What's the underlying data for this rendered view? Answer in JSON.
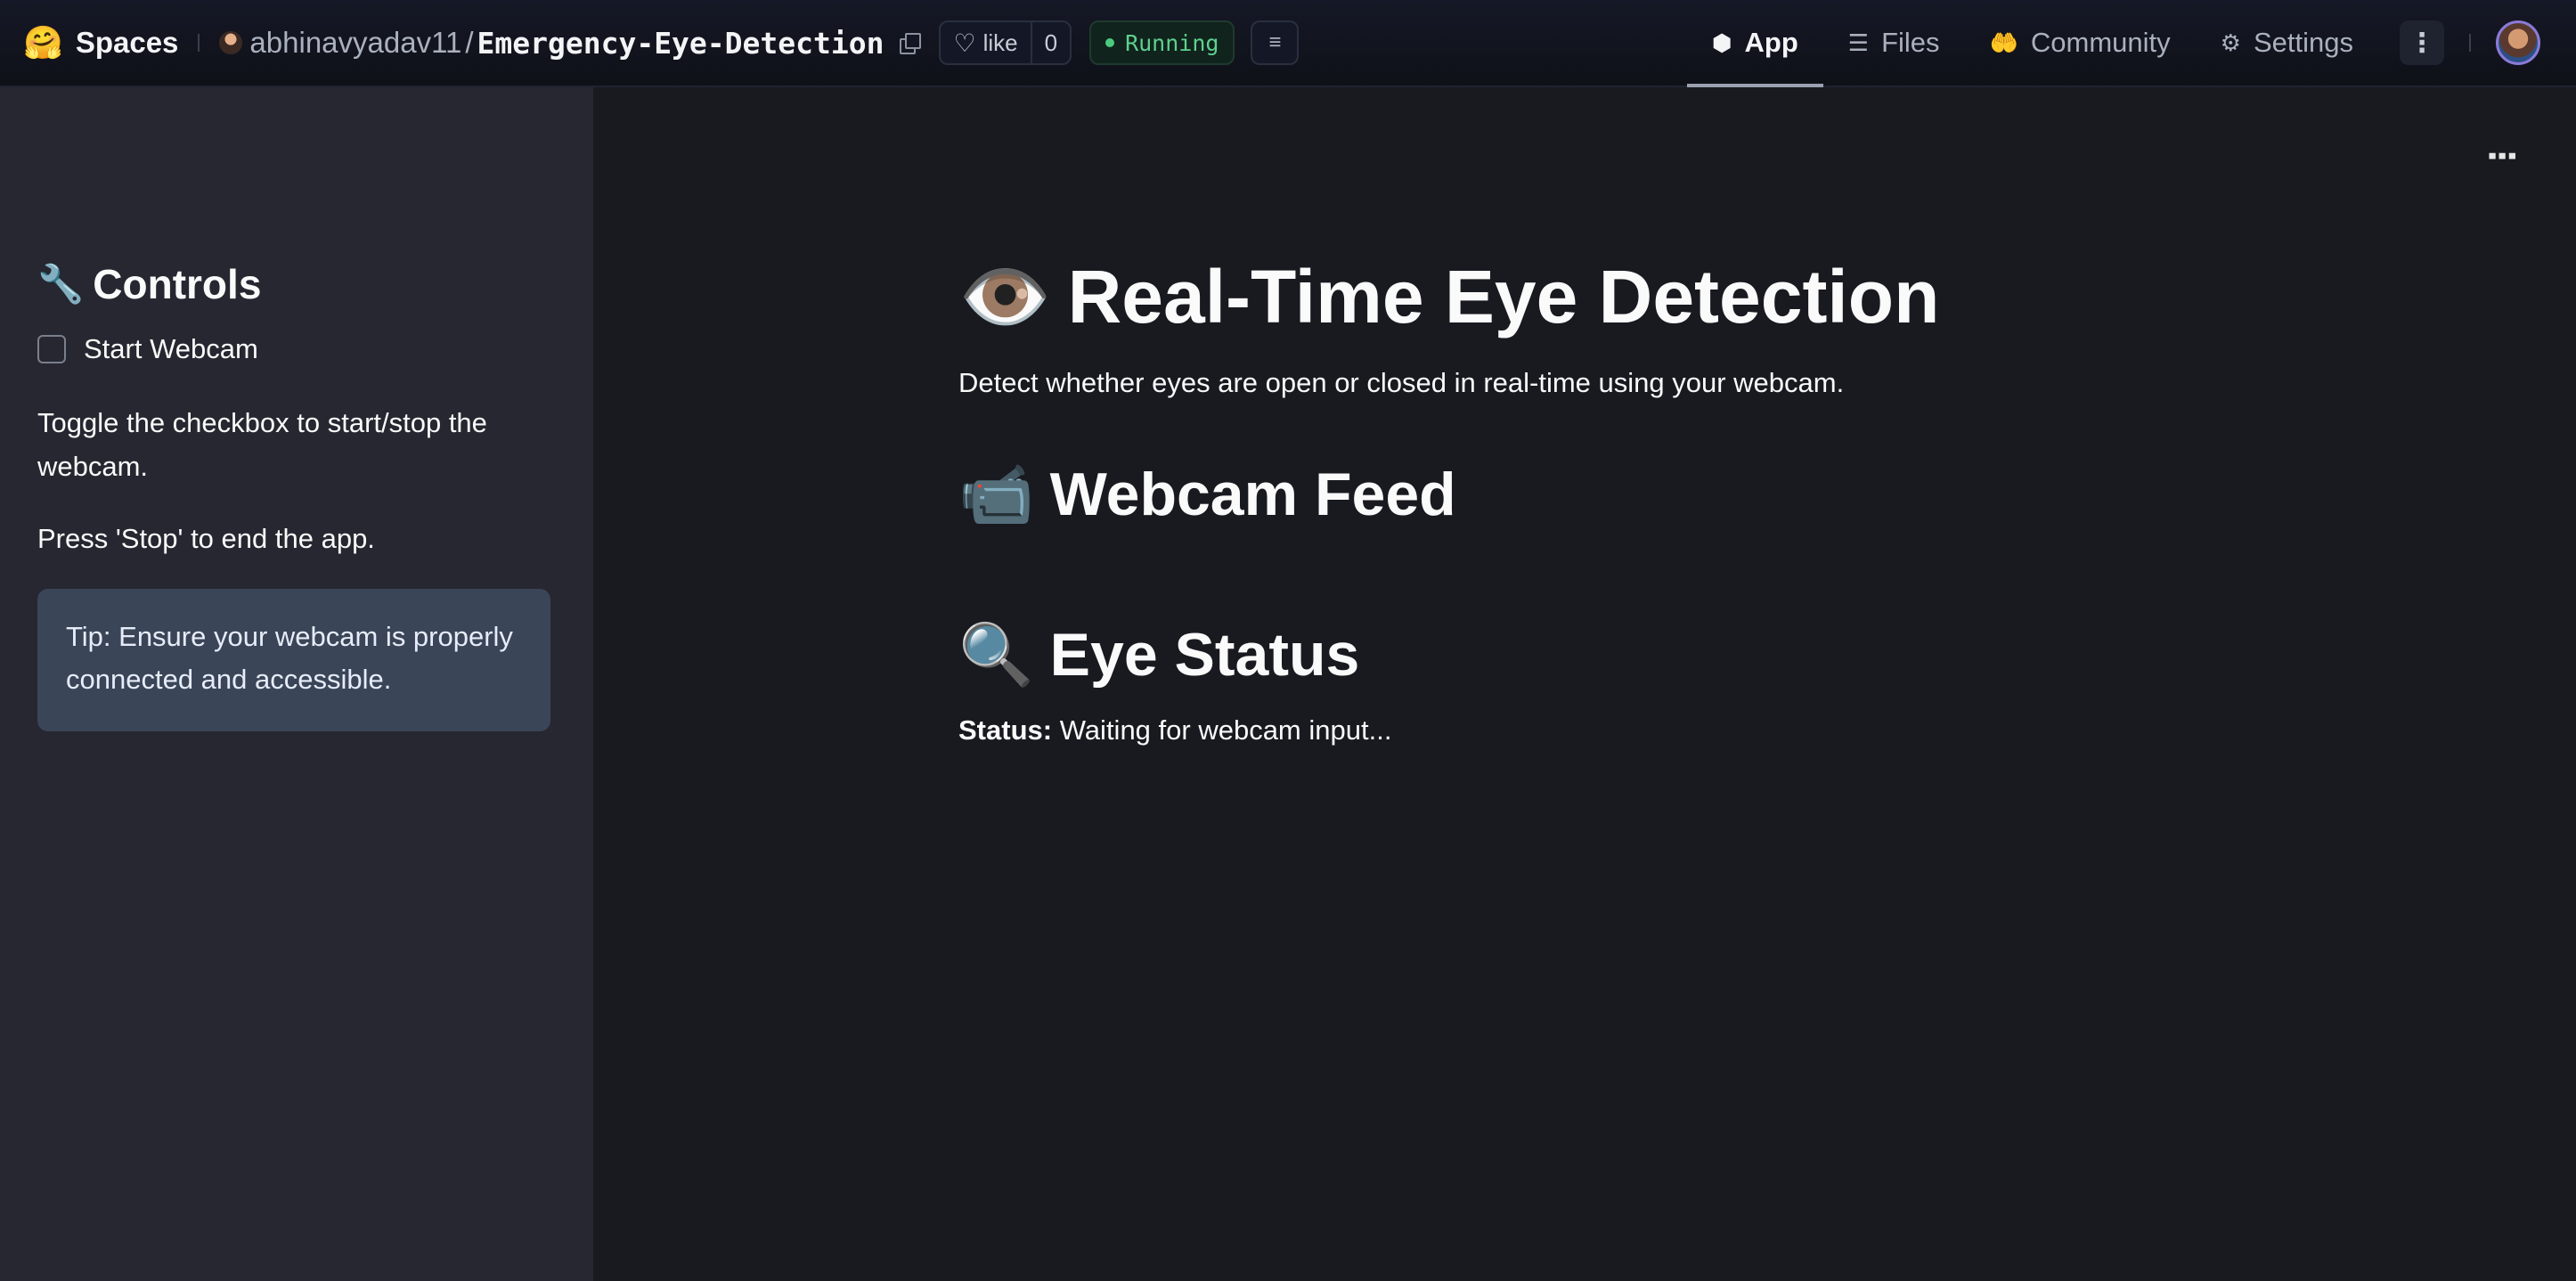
{
  "topbar": {
    "logo_icon": "🤗",
    "spaces_label": "Spaces",
    "owner": "abhinavyadav11",
    "separator": "/",
    "repo": "Emergency-Eye-Detection",
    "like_label": "like",
    "like_count": "0",
    "status": "Running",
    "status_color": "#4ccb7f",
    "tabs": [
      {
        "label": "App",
        "icon": "cube-icon",
        "glyph": "⬢",
        "active": true
      },
      {
        "label": "Files",
        "icon": "files-icon",
        "glyph": "☰",
        "active": false
      },
      {
        "label": "Community",
        "icon": "community-icon",
        "glyph": "🤲",
        "active": false
      },
      {
        "label": "Settings",
        "icon": "gear-icon",
        "glyph": "⚙",
        "active": false
      }
    ],
    "more_glyph": "⋮"
  },
  "sidebar": {
    "title_emoji": "🔧",
    "title": "Controls",
    "checkbox_label": "Start Webcam",
    "checkbox_checked": false,
    "text1": "Toggle the checkbox to start/stop the webcam.",
    "text2": "Press 'Stop' to end the app.",
    "tip": "Tip: Ensure your webcam is properly connected and accessible."
  },
  "main": {
    "menu_glyph": "⋮",
    "title_emoji": "👁️",
    "title": "Real-Time Eye Detection",
    "subtitle": "Detect whether eyes are open or closed in real-time using your webcam.",
    "feed_emoji": "📹",
    "feed_heading": "Webcam Feed",
    "status_emoji": "🔍",
    "status_heading": "Eye Status",
    "status_label": "Status:",
    "status_value": "Waiting for webcam input..."
  },
  "colors": {
    "sidebar_bg": "#262730",
    "main_bg": "#191a20",
    "tip_bg": "#3b4558"
  }
}
